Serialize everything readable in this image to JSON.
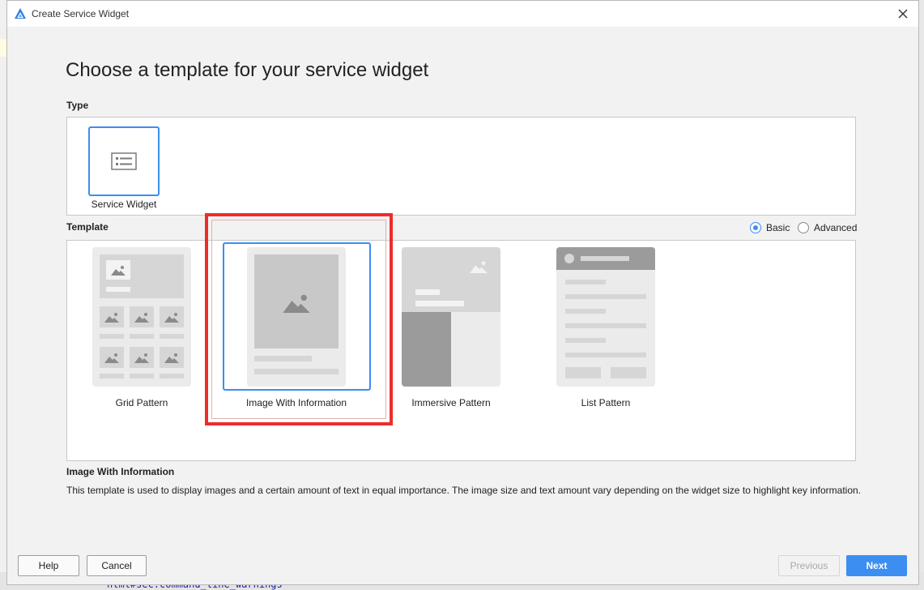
{
  "window": {
    "title": "Create Service Widget"
  },
  "heading": "Choose a template for your service widget",
  "type_section": {
    "label": "Type",
    "items": [
      {
        "label": "Service Widget",
        "icon": "widget-list-icon",
        "selected": true
      }
    ]
  },
  "template_section": {
    "label": "Template",
    "mode_options": [
      {
        "label": "Basic",
        "selected": true
      },
      {
        "label": "Advanced",
        "selected": false
      }
    ],
    "items": [
      {
        "label": "Grid Pattern"
      },
      {
        "label": "Image With Information",
        "selected": true
      },
      {
        "label": "Immersive Pattern"
      },
      {
        "label": "List Pattern"
      }
    ]
  },
  "description": {
    "title": "Image With Information",
    "text": "This template is used to display images and a certain amount of text in equal importance. The image size and text amount vary depending on the widget size to highlight key information."
  },
  "buttons": {
    "help": "Help",
    "cancel": "Cancel",
    "previous": "Previous",
    "next": "Next"
  },
  "background": {
    "code_line": "html#sec:command_line_warnings"
  },
  "colors": {
    "accent": "#3c8ef0",
    "highlight": "#ee2c2c"
  }
}
